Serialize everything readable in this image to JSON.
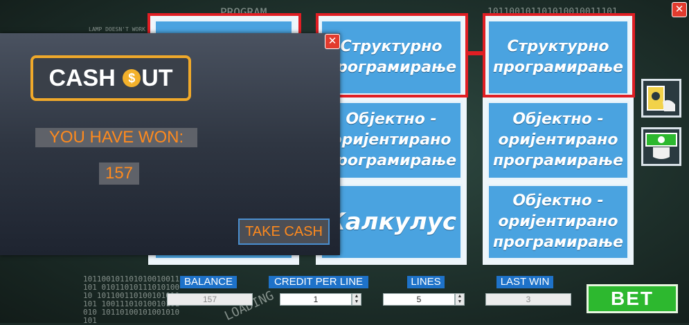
{
  "background": {
    "chalk_program": "PROGRAM",
    "chalk_lamp": "LAMP DOESN'T WORK",
    "chalk_binary_top": "101100101101010010011101",
    "chalk_binary_left": "101100101101010010011101 0101101011101010010 101100110100101010101 10011101010010101010 10110100101001010101",
    "chalk_loading": "LOADING"
  },
  "reels": [
    [
      "",
      "",
      ""
    ],
    [
      "Структурно програмирање",
      "Објектно - оријентирано програмирање",
      "Калкулус"
    ],
    [
      "Структурно програмирање",
      "Објектно - оријентирано програмирање",
      "Објектно - оријентирано програмирање"
    ]
  ],
  "cashout": {
    "logo_left": "CASH ",
    "logo_coin": "$",
    "logo_right": "UT",
    "won_label": "YOU HAVE WON:",
    "won_value": "157",
    "take_cash": "TAKE CASH",
    "close": "✕"
  },
  "controls": {
    "balance_label": "BALANCE",
    "balance_value": "157",
    "credit_label": "CREDIT PER LINE",
    "credit_value": "1",
    "lines_label": "LINES",
    "lines_value": "5",
    "last_win_label": "LAST WIN",
    "last_win_value": "3",
    "bet_label": "BET",
    "close": "✕"
  },
  "colors": {
    "tile": "#4aa3e0",
    "win_frame": "#e01e24",
    "label_bg": "#1e72c9",
    "bet": "#2db82f",
    "accent_text": "#ff8a1d"
  }
}
